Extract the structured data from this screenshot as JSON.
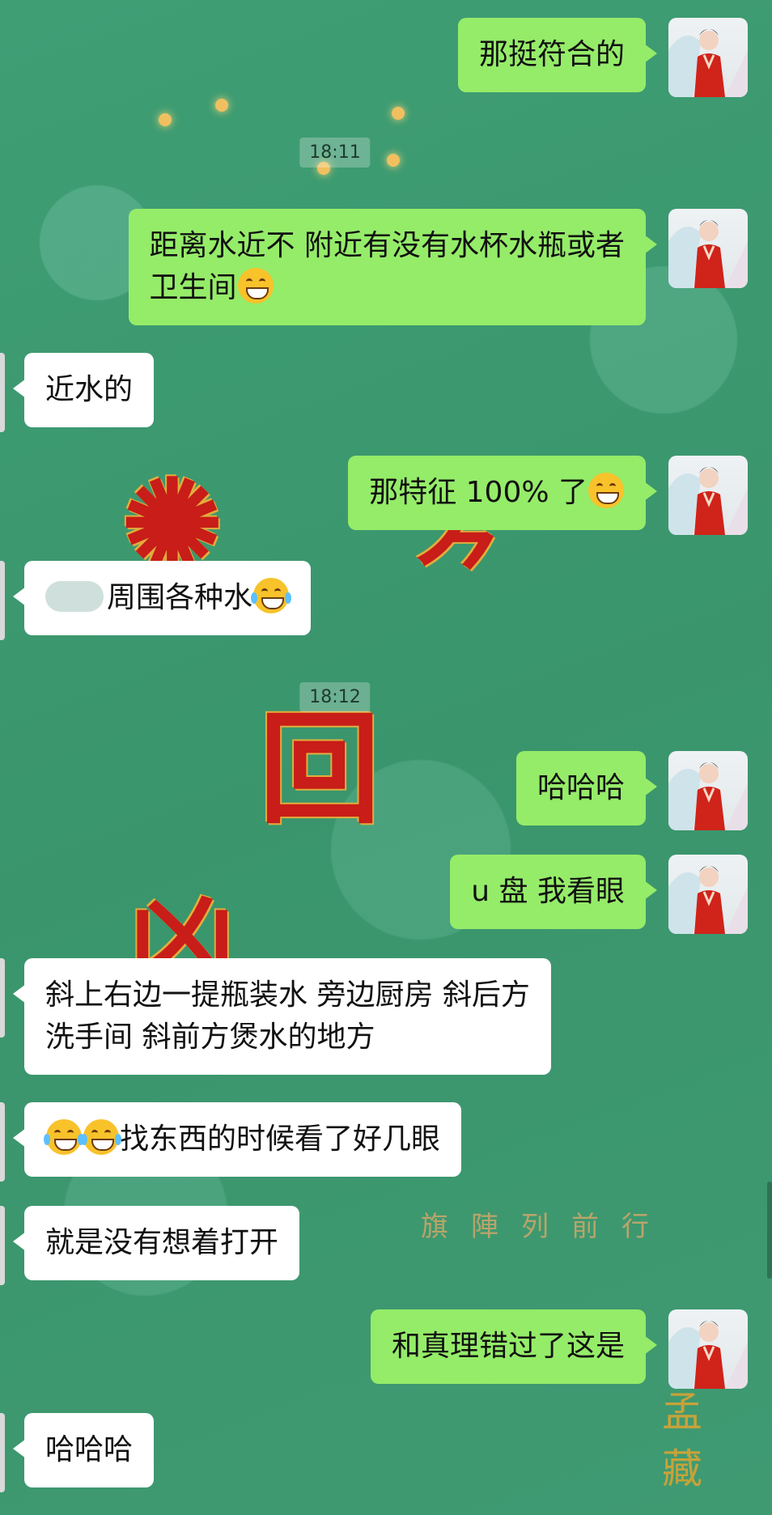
{
  "chat": {
    "timestamps": [
      "18:11",
      "18:12"
    ],
    "messages": [
      {
        "dir": "out",
        "text": "那挺符合的"
      },
      {
        "dir": "out",
        "text": "距离水近不 附近有没有水杯水瓶或者\n卫生间",
        "emoji": "grin"
      },
      {
        "dir": "in",
        "text": "近水的"
      },
      {
        "dir": "out",
        "text": "那特征 100% 了",
        "emoji": "smile"
      },
      {
        "dir": "in",
        "text": "周围各种水",
        "emoji": "joy"
      },
      {
        "dir": "out",
        "text": "哈哈哈"
      },
      {
        "dir": "out",
        "text": "u 盘 我看眼"
      },
      {
        "dir": "in",
        "text": "斜上右边一提瓶装水 旁边厨房 斜后方\n洗手间 斜前方煲水的地方"
      },
      {
        "dir": "in",
        "text": "找东西的时候看了好几眼",
        "emoji_prefix": "joy-joy"
      },
      {
        "dir": "in",
        "text": "就是没有想着打开"
      },
      {
        "dir": "out",
        "text": "和真理错过了这是"
      },
      {
        "dir": "in",
        "text": "哈哈哈"
      }
    ]
  },
  "background": {
    "poster_text": "旗陣列前行",
    "corner_text": "孟藏"
  },
  "colors": {
    "outgoing": "#95ec69",
    "incoming": "#ffffff",
    "background": "#3f9a72"
  }
}
